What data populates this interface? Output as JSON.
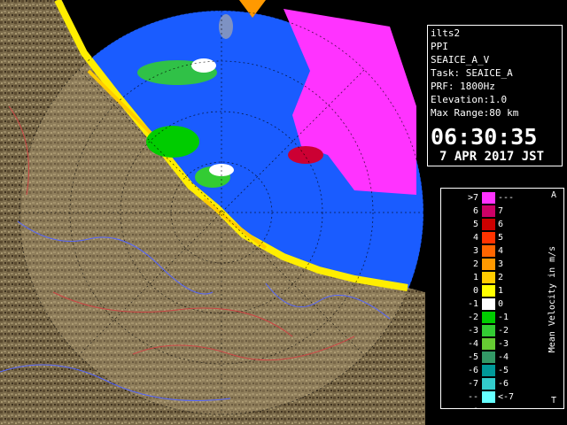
{
  "station": {
    "name": "ilts2",
    "scan_type": "PPI",
    "product": "SEAICE_A_V",
    "task": "Task: SEAICE_A",
    "prf": "PRF: 1800Hz",
    "elevation": "Elevation:1.0",
    "max_range": "Max Range:80 km"
  },
  "time": {
    "clock": "06:30:35",
    "date": "7 APR 2017 JST"
  },
  "legend": {
    "title": "Mean Velocity in m/s",
    "corner_top": "A",
    "corner_bottom": "T",
    "rows": [
      {
        "left": ">7",
        "right": "---",
        "color": "#ff33ff"
      },
      {
        "left": "6",
        "right": "7",
        "color": "#cc0066"
      },
      {
        "left": "5",
        "right": "6",
        "color": "#cc0000"
      },
      {
        "left": "4",
        "right": "5",
        "color": "#ff3300"
      },
      {
        "left": "3",
        "right": "4",
        "color": "#ff6600"
      },
      {
        "left": "2",
        "right": "3",
        "color": "#ff9900"
      },
      {
        "left": "1",
        "right": "2",
        "color": "#ffcc00"
      },
      {
        "left": "0",
        "right": "1",
        "color": "#ffff00"
      },
      {
        "left": "-1",
        "right": "0",
        "color": "#ffffff"
      },
      {
        "left": "-2",
        "right": "-1",
        "color": "#00cc00"
      },
      {
        "left": "-3",
        "right": "-2",
        "color": "#33cc33"
      },
      {
        "left": "-4",
        "right": "-3",
        "color": "#66cc33"
      },
      {
        "left": "-5",
        "right": "-4",
        "color": "#339966"
      },
      {
        "left": "-6",
        "right": "-5",
        "color": "#009999"
      },
      {
        "left": "-7",
        "right": "-6",
        "color": "#33cccc"
      },
      {
        "left": "---",
        "right": "<-7",
        "color": "#66ffff"
      }
    ]
  },
  "colors": {
    "sea": "#1a5cff",
    "land": "#7a6a4a",
    "coast": "#ffee00"
  }
}
